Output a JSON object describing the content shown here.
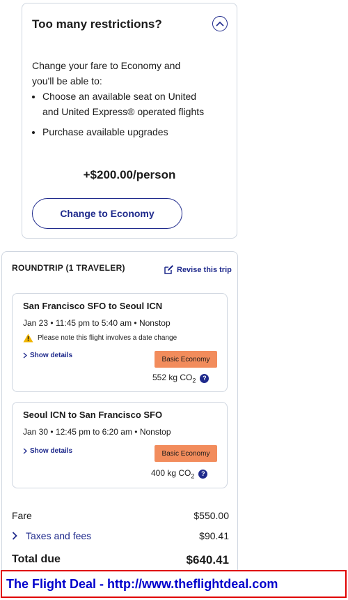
{
  "upsell": {
    "title": "Too many restrictions?",
    "collapse_icon": "chevron-up-icon",
    "intro": "Change your fare to Economy and you'll be able to:",
    "benefits": [
      "Choose an available seat on United and United Express® operated flights",
      "Purchase available upgrades"
    ],
    "price": "+$200.00/person",
    "button_label": "Change to Economy"
  },
  "trip": {
    "header": "ROUNDTRIP (1 TRAVELER)",
    "revise_label": "Revise this trip",
    "segments": [
      {
        "route": "San Francisco SFO to Seoul ICN",
        "times": "Jan 23 • 11:45 pm to 5:40 am • Nonstop",
        "warning": "Please note this flight involves a date change",
        "details_label": "Show details",
        "fare_class": "Basic Economy",
        "co2": "552 kg CO",
        "co2_sub": "2"
      },
      {
        "route": "Seoul ICN to San Francisco SFO",
        "times": "Jan 30 • 12:45 pm to 6:20 am • Nonstop",
        "details_label": "Show details",
        "fare_class": "Basic Economy",
        "co2": "400 kg CO",
        "co2_sub": "2"
      }
    ],
    "fare_label": "Fare",
    "fare_value": "$550.00",
    "taxes_label": "Taxes and fees",
    "taxes_value": "$90.41",
    "total_label": "Total due",
    "total_value": "$640.41"
  },
  "banner": {
    "text": "The Flight Deal - http://www.theflightdeal.com"
  },
  "colors": {
    "accent": "#1f2a8c",
    "badge": "#f28c5c",
    "warning": "#f0b400",
    "banner_border": "#e00000",
    "banner_text": "#0000cc"
  }
}
